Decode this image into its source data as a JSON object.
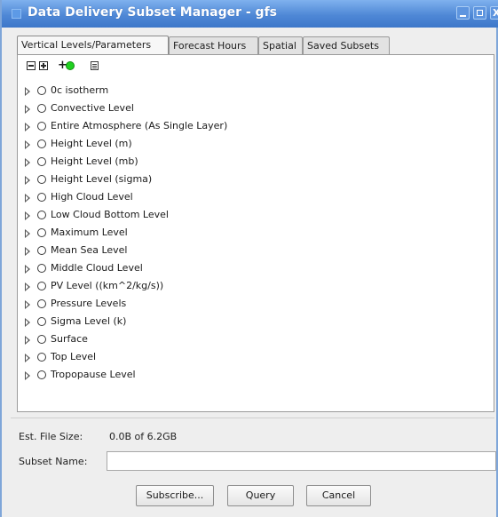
{
  "window": {
    "title": "Data Delivery Subset Manager - gfs",
    "controls": {
      "minimize_icon": "minimize-icon",
      "maximize_icon": "maximize-icon",
      "close_glyph": "X"
    }
  },
  "tabs": [
    {
      "label": "Vertical Levels/Parameters",
      "active": true
    },
    {
      "label": "Forecast Hours",
      "active": false
    },
    {
      "label": "Spatial",
      "active": false
    },
    {
      "label": "Saved Subsets",
      "active": false
    }
  ],
  "tree_toolbar": {
    "icons": [
      "collapse-all-icon",
      "expand-all-icon",
      "add-green-icon",
      "document-icon"
    ],
    "plus_glyph": "+"
  },
  "levels": [
    "0c isotherm",
    "Convective Level",
    "Entire Atmosphere (As Single Layer)",
    "Height Level (m)",
    "Height Level (mb)",
    "Height Level (sigma)",
    "High Cloud Level",
    "Low Cloud Bottom Level",
    "Maximum Level",
    "Mean Sea Level",
    "Middle Cloud Level",
    "PV Level ((km^2/kg/s))",
    "Pressure Levels",
    "Sigma Level (k)",
    "Surface",
    "Top Level",
    "Tropopause Level"
  ],
  "file_size": {
    "label": "Est. File Size:",
    "value": "0.0B of 6.2GB"
  },
  "subset_name": {
    "label": "Subset Name:",
    "value": ""
  },
  "buttons": {
    "subscribe": "Subscribe...",
    "query": "Query",
    "cancel": "Cancel"
  },
  "colors": {
    "titlebar": "#4f88d6",
    "accent_green": "#1fd11f"
  }
}
